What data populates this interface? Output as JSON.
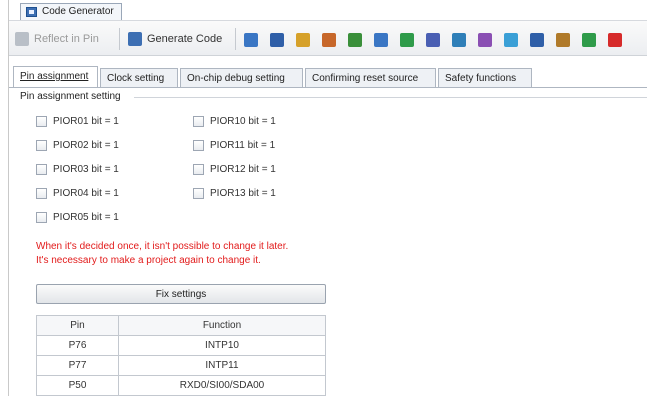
{
  "window": {
    "tab_title": "Code Generator"
  },
  "toolbar": {
    "reflect_label": "Reflect in Pin",
    "generate_label": "Generate Code",
    "icons": [
      {
        "name": "pin-icon",
        "color": "#3a76c4"
      },
      {
        "name": "chip-icon",
        "color": "#2f5fa8"
      },
      {
        "name": "wand-icon",
        "color": "#d6a12a"
      },
      {
        "name": "route-icon",
        "color": "#c7672a"
      },
      {
        "name": "probe-icon",
        "color": "#3a8f3a"
      },
      {
        "name": "pointer-icon",
        "color": "#3a76c4"
      },
      {
        "name": "timer-icon",
        "color": "#2f9b4a"
      },
      {
        "name": "link-icon",
        "color": "#4a5fb3"
      },
      {
        "name": "window-icon",
        "color": "#2f7fb8"
      },
      {
        "name": "gear-icon",
        "color": "#8a4fb3"
      },
      {
        "name": "plugin-icon",
        "color": "#3a9fd6"
      },
      {
        "name": "speaker-icon",
        "color": "#2f5fa8"
      },
      {
        "name": "tree-icon",
        "color": "#b07a2a"
      },
      {
        "name": "network-icon",
        "color": "#2f9b4a"
      },
      {
        "name": "alert-icon",
        "color": "#d62a2a"
      }
    ]
  },
  "tabs": [
    {
      "label": "Pin assignment",
      "active": true
    },
    {
      "label": "Clock setting",
      "active": false
    },
    {
      "label": "On-chip debug setting",
      "active": false
    },
    {
      "label": "Confirming reset source",
      "active": false
    },
    {
      "label": "Safety functions",
      "active": false
    }
  ],
  "group": {
    "title": "Pin assignment setting"
  },
  "checkboxes": {
    "col1": [
      "PIOR01 bit = 1",
      "PIOR02 bit = 1",
      "PIOR03 bit = 1",
      "PIOR04 bit = 1",
      "PIOR05 bit = 1"
    ],
    "col2": [
      "PIOR10 bit = 1",
      "PIOR11 bit = 1",
      "PIOR12 bit = 1",
      "PIOR13 bit = 1"
    ]
  },
  "warning": {
    "line1": "When it's decided once, it isn't possible to change it later.",
    "line2": "It's necessary to make a project again to change it."
  },
  "fix_button": "Fix settings",
  "pin_table": {
    "headers": [
      "Pin",
      "Function"
    ],
    "rows": [
      [
        "P76",
        "INTP10"
      ],
      [
        "P77",
        "INTP11"
      ],
      [
        "P50",
        "RXD0/SI00/SDA00"
      ]
    ]
  }
}
